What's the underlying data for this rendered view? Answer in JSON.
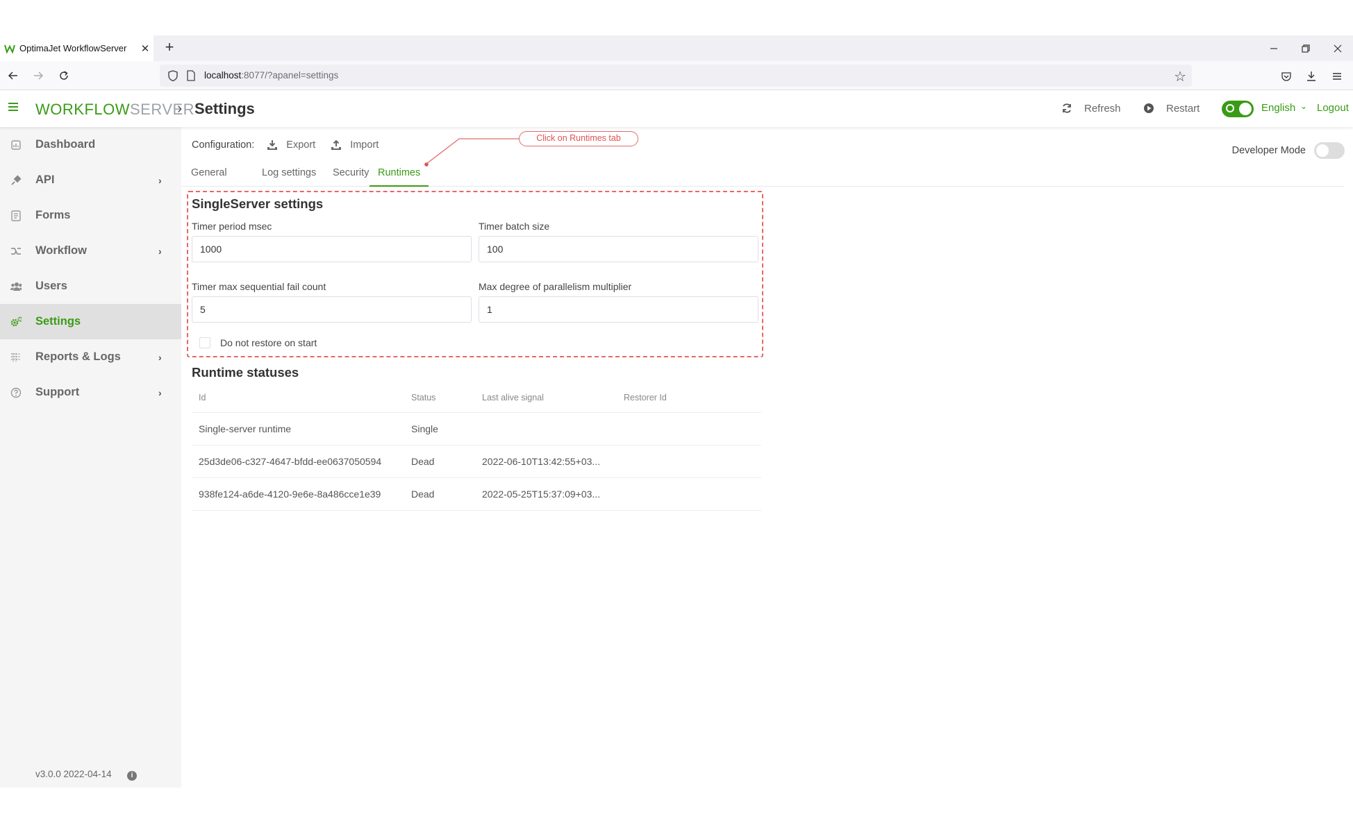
{
  "browser": {
    "tab_title": "OptimaJet WorkflowServer",
    "tab_close": "✕",
    "new_tab": "+",
    "url_host": "localhost",
    "url_rest": ":8077/?apanel=settings"
  },
  "header": {
    "brand_part1": "WORKFLOW",
    "brand_part2": "SERVER",
    "breadcrumb_sep": "›",
    "page_title": "Settings",
    "refresh_label": "Refresh",
    "restart_label": "Restart",
    "language": "English",
    "logout_label": "Logout"
  },
  "sidebar": {
    "items": [
      {
        "label": "Dashboard",
        "icon": "dashboard-icon"
      },
      {
        "label": "API",
        "icon": "plug-icon",
        "expandable": true
      },
      {
        "label": "Forms",
        "icon": "form-icon"
      },
      {
        "label": "Workflow",
        "icon": "workflow-icon",
        "expandable": true
      },
      {
        "label": "Users",
        "icon": "users-icon"
      },
      {
        "label": "Settings",
        "icon": "gears-icon",
        "active": true
      },
      {
        "label": "Reports & Logs",
        "icon": "report-icon",
        "expandable": true
      },
      {
        "label": "Support",
        "icon": "help-icon",
        "expandable": true
      }
    ],
    "version": "v3.0.0 2022-04-14"
  },
  "main": {
    "config_label": "Configuration:",
    "export_label": "Export",
    "import_label": "Import",
    "developer_mode_label": "Developer Mode",
    "developer_mode_on": false,
    "tabs": [
      "General",
      "Log settings",
      "Security",
      "Runtimes"
    ],
    "active_tab": "Runtimes",
    "callout_text": "Click on Runtimes tab",
    "singleserver": {
      "title": "SingleServer settings",
      "timer_period_label": "Timer period msec",
      "timer_period_value": "1000",
      "timer_batch_label": "Timer batch size",
      "timer_batch_value": "100",
      "fail_count_label": "Timer max sequential fail count",
      "fail_count_value": "5",
      "parallelism_label": "Max degree of parallelism multiplier",
      "parallelism_value": "1",
      "restore_label": "Do not restore on start",
      "restore_checked": false
    },
    "runtime_statuses": {
      "title": "Runtime statuses",
      "columns": [
        "Id",
        "Status",
        "Last alive signal",
        "Restorer Id"
      ],
      "rows": [
        {
          "id": "Single-server runtime",
          "status": "Single",
          "last_alive": "",
          "restorer": ""
        },
        {
          "id": "25d3de06-c327-4647-bfdd-ee0637050594",
          "status": "Dead",
          "last_alive": "2022-06-10T13:42:55+03...",
          "restorer": ""
        },
        {
          "id": "938fe124-a6de-4120-9e6e-8a486cce1e39",
          "status": "Dead",
          "last_alive": "2022-05-25T15:37:09+03...",
          "restorer": ""
        }
      ]
    }
  },
  "colors": {
    "accent": "#3a9b16",
    "highlight": "#e86565",
    "sidebar_bg": "#f5f5f5"
  }
}
